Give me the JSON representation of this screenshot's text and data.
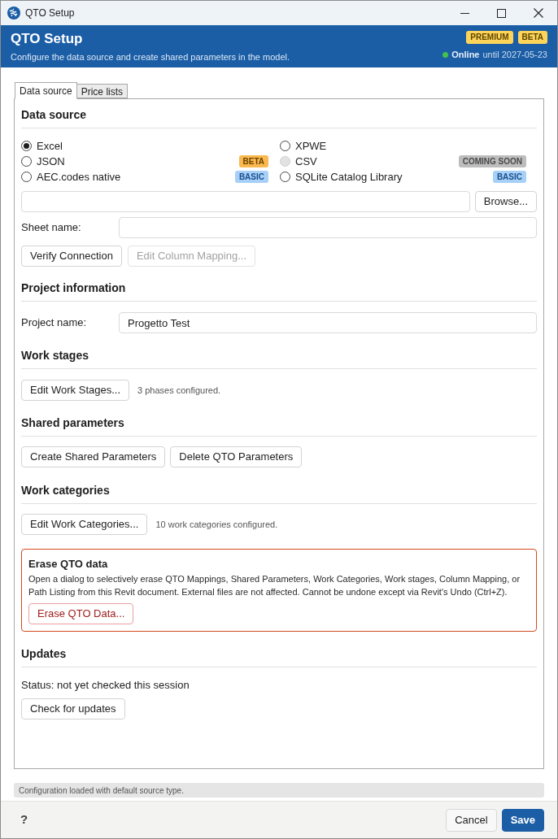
{
  "window": {
    "title": "QTO Setup"
  },
  "header": {
    "title": "QTO Setup",
    "subtitle": "Configure the data source and create shared parameters in the model.",
    "badges": [
      "PREMIUM",
      "BETA"
    ],
    "status": {
      "online": true,
      "label": "Online",
      "detail": "until 2027-05-23"
    }
  },
  "tabs": [
    {
      "label": "Data source",
      "selected": true
    },
    {
      "label": "Price lists",
      "selected": false
    }
  ],
  "data_source": {
    "heading": "Data source",
    "options": [
      {
        "label": "Excel",
        "selected": true,
        "disabled": false
      },
      {
        "label": "XPWE",
        "selected": false,
        "disabled": false
      },
      {
        "label": "JSON",
        "selected": false,
        "disabled": false,
        "badge": {
          "label": "BETA",
          "kind": "beta"
        }
      },
      {
        "label": "CSV",
        "selected": false,
        "disabled": true,
        "badge": {
          "label": "COMING SOON",
          "kind": "soon"
        }
      },
      {
        "label": "AEC.codes native",
        "selected": false,
        "disabled": false,
        "badge": {
          "label": "BASIC",
          "kind": "basic"
        }
      },
      {
        "label": "SQLite Catalog Library",
        "selected": false,
        "disabled": false,
        "badge": {
          "label": "BASIC",
          "kind": "basic"
        }
      }
    ],
    "browse_button": "Browse...",
    "sheet_name": {
      "label": "Sheet name:"
    },
    "buttons": [
      {
        "label": "Verify Connection",
        "disabled": false
      },
      {
        "label": "Edit Column Mapping...",
        "disabled": true
      }
    ]
  },
  "project_information": {
    "heading": "Project information",
    "project_name": {
      "label": "Project name:",
      "value": "Progetto Test"
    }
  },
  "work_stages": {
    "heading": "Work stages",
    "button": "Edit Work Stages...",
    "note": "3 phases configured."
  },
  "shared_parameters": {
    "heading": "Shared parameters",
    "buttons": [
      "Create Shared Parameters",
      "Delete QTO Parameters"
    ]
  },
  "work_categories": {
    "heading": "Work categories",
    "button": "Edit Work Categories...",
    "note": "10 work categories configured."
  },
  "erase": {
    "title": "Erase QTO data",
    "text": "Open a dialog to selectively erase QTO Mappings, Shared Parameters, Work Categories, Work stages, Column Mapping, or Path Listing from this Revit document. External files are not affected. Cannot be undone except via Revit's Undo (Ctrl+Z).",
    "button": "Erase QTO Data..."
  },
  "updates": {
    "heading": "Updates",
    "status": "Status: not yet checked this session",
    "button": "Check for updates"
  },
  "status_bar": "Configuration loaded with default source type.",
  "footer": {
    "help": "?",
    "buttons": [
      {
        "label": "Cancel",
        "primary": false
      },
      {
        "label": "Save",
        "primary": true
      }
    ]
  }
}
